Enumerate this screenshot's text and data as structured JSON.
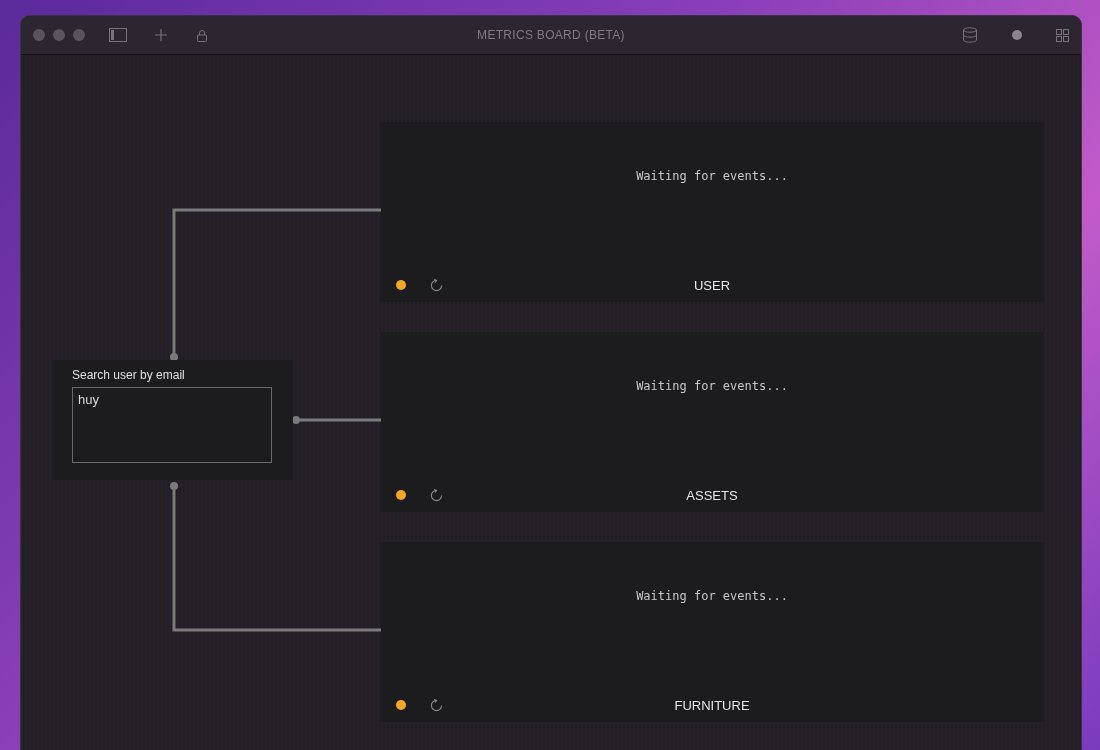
{
  "window": {
    "title": "METRICS BOARD (BETA)"
  },
  "search_node": {
    "label": "Search user by email",
    "value": "huy"
  },
  "panels": [
    {
      "message": "Waiting for events...",
      "name": "USER",
      "color": "#f5a623"
    },
    {
      "message": "Waiting for events...",
      "name": "ASSETS",
      "color": "#f5a623"
    },
    {
      "message": "Waiting for events...",
      "name": "FURNITURE",
      "color": "#f5a623"
    }
  ]
}
